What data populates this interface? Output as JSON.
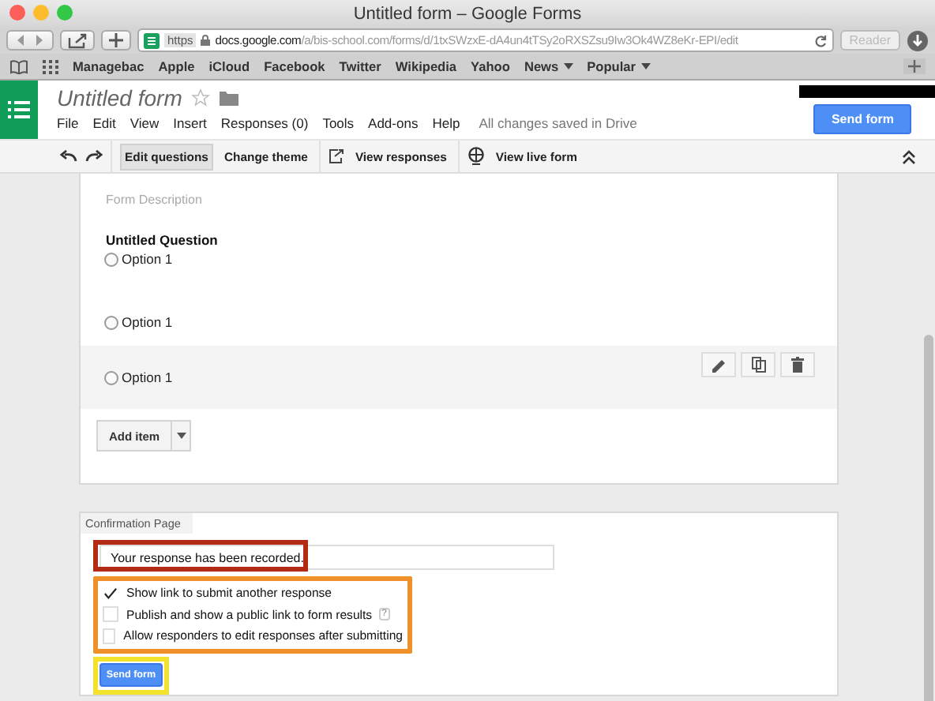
{
  "window": {
    "title": "Untitled form – Google Forms"
  },
  "browser": {
    "scheme": "https",
    "host": "docs.google.com",
    "path": "/a/bis-school.com/forms/d/1txSWzxE-dA4un4tTSy2oRXSZsu9Iw3Ok4WZ8eKr-EPI/edit",
    "reader": "Reader",
    "bookmarks": [
      {
        "label": "Managebac",
        "menu": false
      },
      {
        "label": "Apple",
        "menu": false
      },
      {
        "label": "iCloud",
        "menu": false
      },
      {
        "label": "Facebook",
        "menu": false
      },
      {
        "label": "Twitter",
        "menu": false
      },
      {
        "label": "Wikipedia",
        "menu": false
      },
      {
        "label": "Yahoo",
        "menu": false
      },
      {
        "label": "News",
        "menu": true
      },
      {
        "label": "Popular",
        "menu": true
      }
    ]
  },
  "app": {
    "doc_title": "Untitled form",
    "menu": [
      "File",
      "Edit",
      "View",
      "Insert",
      "Responses (0)",
      "Tools",
      "Add-ons",
      "Help"
    ],
    "save_status": "All changes saved in Drive",
    "send_button": "Send form"
  },
  "toolbar": {
    "tabs": [
      {
        "label": "Edit questions",
        "selected": true
      },
      {
        "label": "Change theme",
        "selected": false
      }
    ],
    "view_responses": "View responses",
    "view_live": "View live form"
  },
  "form": {
    "description_placeholder": "Form Description",
    "question": "Untitled Question",
    "options": [
      {
        "label": "Option 1",
        "hovered": false,
        "selected": false
      },
      {
        "label": "Option 1",
        "hovered": false,
        "selected": false
      },
      {
        "label": "Option 1",
        "hovered": true,
        "selected": false
      }
    ],
    "add_item": "Add item"
  },
  "confirmation": {
    "heading": "Confirmation Page",
    "message": "Your response has been recorded.",
    "settings": [
      {
        "label": "Show link to submit another response",
        "checked": true,
        "help": false
      },
      {
        "label": "Publish and show a public link to form results",
        "checked": false,
        "help": true
      },
      {
        "label": "Allow responders to edit responses after submitting",
        "checked": false,
        "help": false
      }
    ],
    "help_mark": "?",
    "send_button": "Send form"
  }
}
